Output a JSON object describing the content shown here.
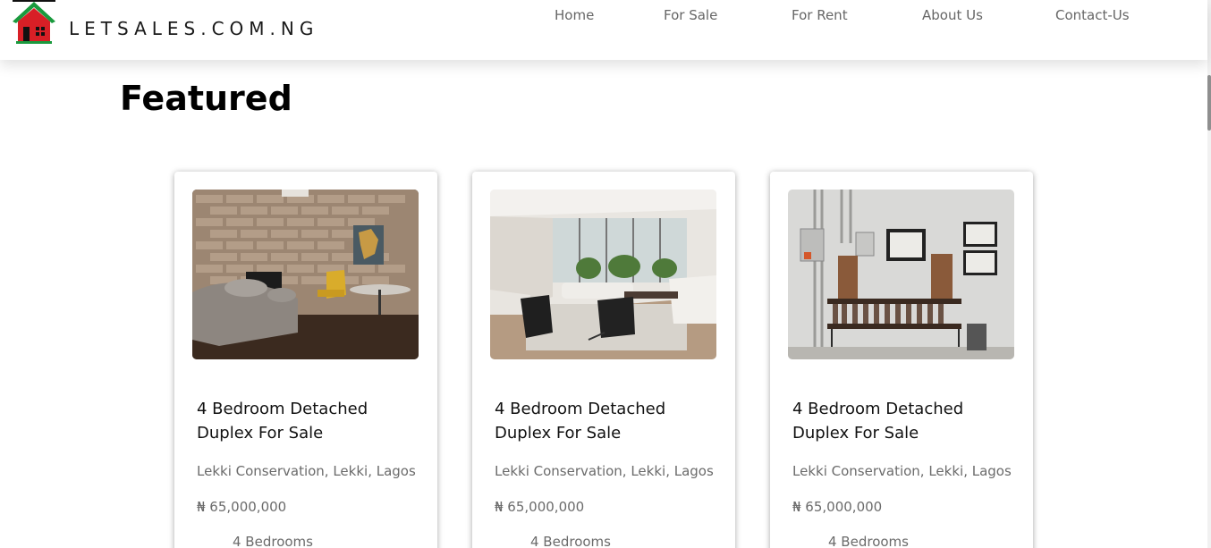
{
  "brand": {
    "name": "LETSALES.COM.NG"
  },
  "nav": {
    "items": [
      "Home",
      "For Sale",
      "For Rent",
      "About Us",
      "Contact-Us"
    ]
  },
  "section": {
    "title": "Featured"
  },
  "currency_symbol": "₦",
  "listings": [
    {
      "title": "4 Bedroom Detached Duplex For Sale",
      "location": "Lekki Conservation, Lekki, Lagos",
      "price": "₦ 65,000,000",
      "bedrooms": "4 Bedrooms"
    },
    {
      "title": "4 Bedroom Detached Duplex For Sale",
      "location": "Lekki Conservation, Lekki, Lagos",
      "price": "₦ 65,000,000",
      "bedrooms": "4 Bedrooms"
    },
    {
      "title": "4 Bedroom Detached Duplex For Sale",
      "location": "Lekki Conservation, Lekki, Lagos",
      "price": "₦ 65,000,000",
      "bedrooms": "4 Bedrooms"
    }
  ],
  "colors": {
    "logo_house": "#d81f26",
    "logo_roof": "#1a9a3e",
    "nav_text": "#666666",
    "meta_text": "#6b6b6b"
  }
}
